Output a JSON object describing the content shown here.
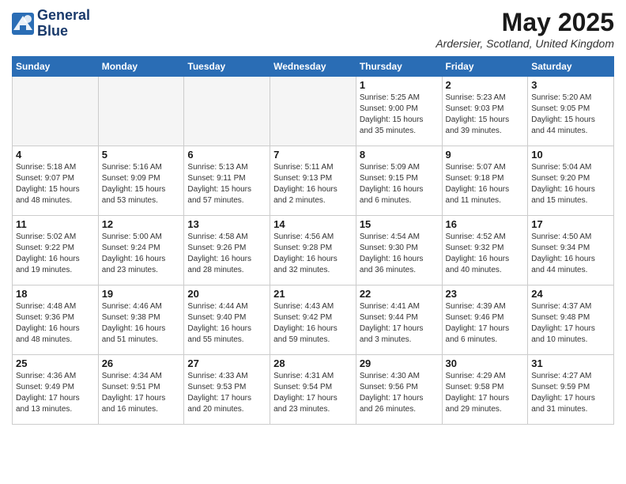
{
  "header": {
    "logo_line1": "General",
    "logo_line2": "Blue",
    "month_title": "May 2025",
    "location": "Ardersier, Scotland, United Kingdom"
  },
  "days_of_week": [
    "Sunday",
    "Monday",
    "Tuesday",
    "Wednesday",
    "Thursday",
    "Friday",
    "Saturday"
  ],
  "weeks": [
    [
      {
        "num": "",
        "info": ""
      },
      {
        "num": "",
        "info": ""
      },
      {
        "num": "",
        "info": ""
      },
      {
        "num": "",
        "info": ""
      },
      {
        "num": "1",
        "info": "Sunrise: 5:25 AM\nSunset: 9:00 PM\nDaylight: 15 hours\nand 35 minutes."
      },
      {
        "num": "2",
        "info": "Sunrise: 5:23 AM\nSunset: 9:03 PM\nDaylight: 15 hours\nand 39 minutes."
      },
      {
        "num": "3",
        "info": "Sunrise: 5:20 AM\nSunset: 9:05 PM\nDaylight: 15 hours\nand 44 minutes."
      }
    ],
    [
      {
        "num": "4",
        "info": "Sunrise: 5:18 AM\nSunset: 9:07 PM\nDaylight: 15 hours\nand 48 minutes."
      },
      {
        "num": "5",
        "info": "Sunrise: 5:16 AM\nSunset: 9:09 PM\nDaylight: 15 hours\nand 53 minutes."
      },
      {
        "num": "6",
        "info": "Sunrise: 5:13 AM\nSunset: 9:11 PM\nDaylight: 15 hours\nand 57 minutes."
      },
      {
        "num": "7",
        "info": "Sunrise: 5:11 AM\nSunset: 9:13 PM\nDaylight: 16 hours\nand 2 minutes."
      },
      {
        "num": "8",
        "info": "Sunrise: 5:09 AM\nSunset: 9:15 PM\nDaylight: 16 hours\nand 6 minutes."
      },
      {
        "num": "9",
        "info": "Sunrise: 5:07 AM\nSunset: 9:18 PM\nDaylight: 16 hours\nand 11 minutes."
      },
      {
        "num": "10",
        "info": "Sunrise: 5:04 AM\nSunset: 9:20 PM\nDaylight: 16 hours\nand 15 minutes."
      }
    ],
    [
      {
        "num": "11",
        "info": "Sunrise: 5:02 AM\nSunset: 9:22 PM\nDaylight: 16 hours\nand 19 minutes."
      },
      {
        "num": "12",
        "info": "Sunrise: 5:00 AM\nSunset: 9:24 PM\nDaylight: 16 hours\nand 23 minutes."
      },
      {
        "num": "13",
        "info": "Sunrise: 4:58 AM\nSunset: 9:26 PM\nDaylight: 16 hours\nand 28 minutes."
      },
      {
        "num": "14",
        "info": "Sunrise: 4:56 AM\nSunset: 9:28 PM\nDaylight: 16 hours\nand 32 minutes."
      },
      {
        "num": "15",
        "info": "Sunrise: 4:54 AM\nSunset: 9:30 PM\nDaylight: 16 hours\nand 36 minutes."
      },
      {
        "num": "16",
        "info": "Sunrise: 4:52 AM\nSunset: 9:32 PM\nDaylight: 16 hours\nand 40 minutes."
      },
      {
        "num": "17",
        "info": "Sunrise: 4:50 AM\nSunset: 9:34 PM\nDaylight: 16 hours\nand 44 minutes."
      }
    ],
    [
      {
        "num": "18",
        "info": "Sunrise: 4:48 AM\nSunset: 9:36 PM\nDaylight: 16 hours\nand 48 minutes."
      },
      {
        "num": "19",
        "info": "Sunrise: 4:46 AM\nSunset: 9:38 PM\nDaylight: 16 hours\nand 51 minutes."
      },
      {
        "num": "20",
        "info": "Sunrise: 4:44 AM\nSunset: 9:40 PM\nDaylight: 16 hours\nand 55 minutes."
      },
      {
        "num": "21",
        "info": "Sunrise: 4:43 AM\nSunset: 9:42 PM\nDaylight: 16 hours\nand 59 minutes."
      },
      {
        "num": "22",
        "info": "Sunrise: 4:41 AM\nSunset: 9:44 PM\nDaylight: 17 hours\nand 3 minutes."
      },
      {
        "num": "23",
        "info": "Sunrise: 4:39 AM\nSunset: 9:46 PM\nDaylight: 17 hours\nand 6 minutes."
      },
      {
        "num": "24",
        "info": "Sunrise: 4:37 AM\nSunset: 9:48 PM\nDaylight: 17 hours\nand 10 minutes."
      }
    ],
    [
      {
        "num": "25",
        "info": "Sunrise: 4:36 AM\nSunset: 9:49 PM\nDaylight: 17 hours\nand 13 minutes."
      },
      {
        "num": "26",
        "info": "Sunrise: 4:34 AM\nSunset: 9:51 PM\nDaylight: 17 hours\nand 16 minutes."
      },
      {
        "num": "27",
        "info": "Sunrise: 4:33 AM\nSunset: 9:53 PM\nDaylight: 17 hours\nand 20 minutes."
      },
      {
        "num": "28",
        "info": "Sunrise: 4:31 AM\nSunset: 9:54 PM\nDaylight: 17 hours\nand 23 minutes."
      },
      {
        "num": "29",
        "info": "Sunrise: 4:30 AM\nSunset: 9:56 PM\nDaylight: 17 hours\nand 26 minutes."
      },
      {
        "num": "30",
        "info": "Sunrise: 4:29 AM\nSunset: 9:58 PM\nDaylight: 17 hours\nand 29 minutes."
      },
      {
        "num": "31",
        "info": "Sunrise: 4:27 AM\nSunset: 9:59 PM\nDaylight: 17 hours\nand 31 minutes."
      }
    ]
  ]
}
